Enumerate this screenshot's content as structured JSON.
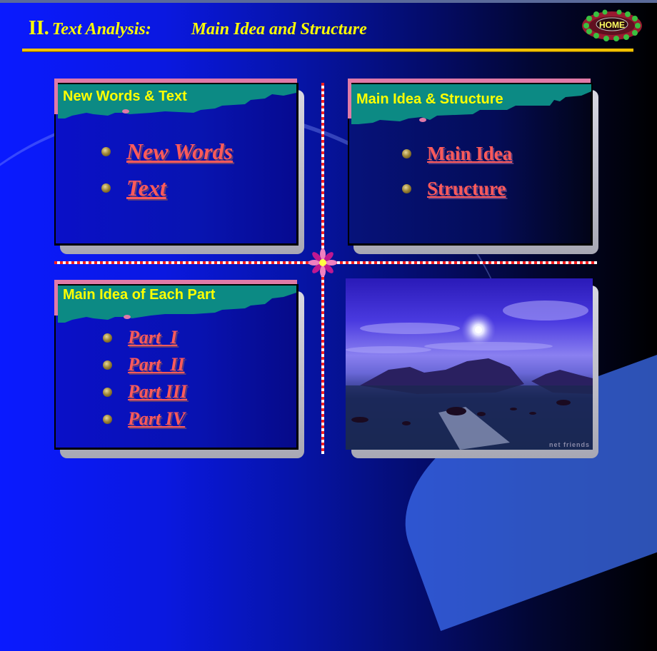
{
  "header": {
    "section_number": "II.",
    "section_title": "Text Analysis:",
    "subtitle": "Main Idea and Structure",
    "home_button": "HOME"
  },
  "colors": {
    "title": "#ffff00",
    "rule": "#f2c200",
    "link": "#ff5a5a",
    "panel_heading_bg": "#0c8a84",
    "panel_accent": "#e07aa8"
  },
  "panels": [
    {
      "heading": "New Words & Text",
      "links": [
        {
          "label": "New Words"
        },
        {
          "label": "Text"
        }
      ]
    },
    {
      "heading": "Main Idea & Structure",
      "links": [
        {
          "label": "Main Idea"
        },
        {
          "label": "Structure"
        }
      ]
    },
    {
      "heading": "Main Idea of Each Part",
      "links": [
        {
          "label": "Part  I"
        },
        {
          "label": "Part  II"
        },
        {
          "label": "Part III"
        },
        {
          "label": "Part IV"
        }
      ]
    }
  ],
  "image": {
    "description": "night seascape with mountains and moon",
    "watermark": "net friends"
  }
}
